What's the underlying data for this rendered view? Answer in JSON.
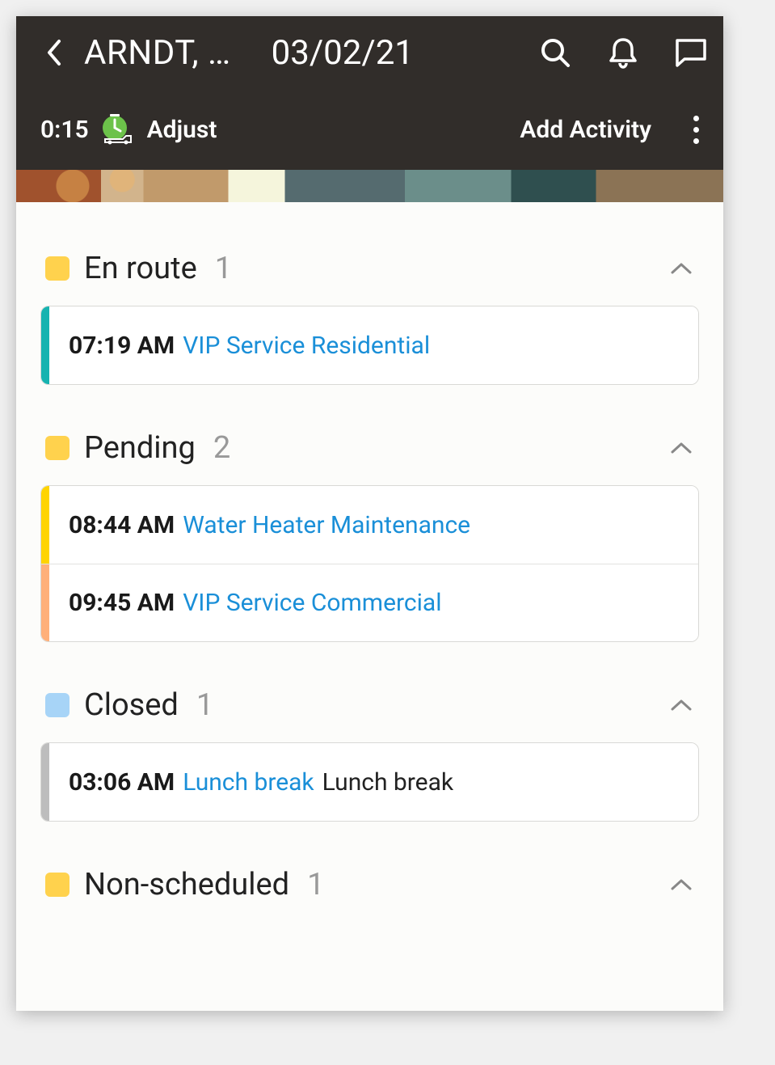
{
  "header": {
    "name": "ARNDT, …",
    "date": "03/02/21"
  },
  "toolbar": {
    "time": "0:15",
    "adjust_label": "Adjust",
    "add_activity_label": "Add Activity"
  },
  "sections": [
    {
      "status_color": "yellow",
      "title": "En route",
      "count": "1",
      "items": [
        {
          "stripe": "teal",
          "time": "07:19 AM",
          "link": "VIP Service Residential",
          "extra": ""
        }
      ]
    },
    {
      "status_color": "yellow",
      "title": "Pending",
      "count": "2",
      "items": [
        {
          "stripe": "yellow",
          "time": "08:44 AM",
          "link": "Water Heater Maintenance",
          "extra": ""
        },
        {
          "stripe": "orange",
          "time": "09:45 AM",
          "link": "VIP Service Commercial",
          "extra": ""
        }
      ]
    },
    {
      "status_color": "blue",
      "title": "Closed",
      "count": "1",
      "items": [
        {
          "stripe": "gray",
          "time": "03:06 AM",
          "link": "Lunch break",
          "extra": "Lunch break"
        }
      ]
    },
    {
      "status_color": "yellow",
      "title": "Non-scheduled",
      "count": "1",
      "items": []
    }
  ]
}
